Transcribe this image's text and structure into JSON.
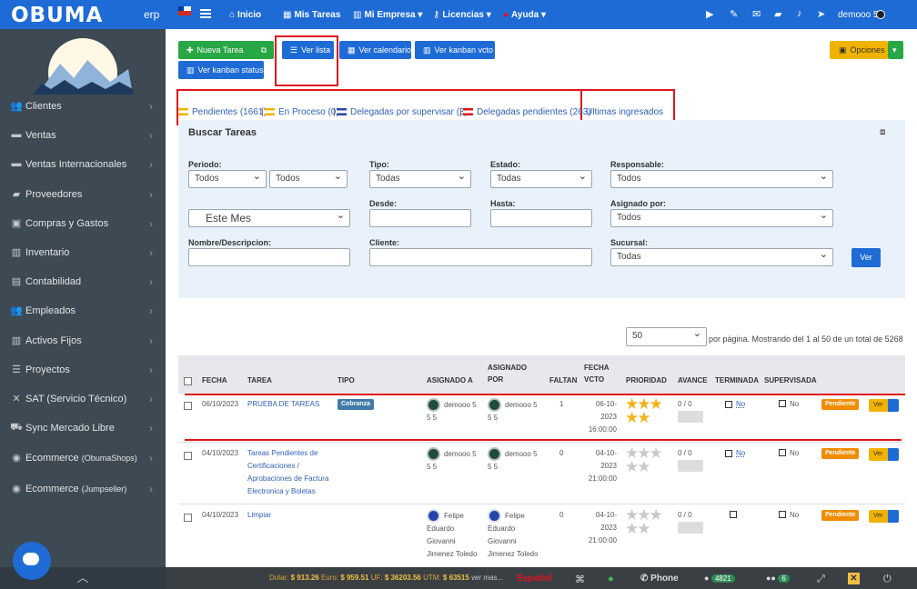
{
  "topbar": {
    "logo": "OBUMA",
    "logo_suffix": "erp",
    "nav": [
      "Inicio",
      "Mis Tareas",
      "Mi Empresa",
      "Licencias",
      "Ayuda"
    ],
    "user": "demooo 5"
  },
  "sidebar": {
    "items": [
      {
        "label": "Clientes",
        "icon": "users-icon"
      },
      {
        "label": "Ventas",
        "icon": "money-icon"
      },
      {
        "label": "Ventas Internacionales",
        "icon": "money-icon"
      },
      {
        "label": "Proveedores",
        "icon": "truck-icon"
      },
      {
        "label": "Compras y Gastos",
        "icon": "receipt-icon"
      },
      {
        "label": "Inventario",
        "icon": "barcode-icon"
      },
      {
        "label": "Contabilidad",
        "icon": "book-icon"
      },
      {
        "label": "Empleados",
        "icon": "users-icon"
      },
      {
        "label": "Activos Fijos",
        "icon": "barcode-icon"
      },
      {
        "label": "Proyectos",
        "icon": "list-icon"
      },
      {
        "label": "SAT (Servicio Técnico)",
        "icon": "tools-icon"
      },
      {
        "label": "Sync Mercado Libre",
        "icon": "cart-icon"
      },
      {
        "label": "Ecommerce",
        "sub": "(ObumaShops)",
        "icon": "globe-icon"
      },
      {
        "label": "Ecommerce",
        "sub": "(Jumpseller)",
        "icon": "globe-icon"
      }
    ]
  },
  "toolbar": {
    "nueva_tarea": "Nueva Tarea",
    "ver_lista": "Ver lista",
    "ver_calendario": "Ver calendario",
    "ver_kanban_vcto": "Ver kanban vcto",
    "ver_kanban_status": "Ver kanban status",
    "opciones": "Opciones"
  },
  "filters": {
    "pendientes": "Pendientes (1661)",
    "en_proceso": "En Proceso (0)",
    "delegadas_supervisar": "Delegadas por supervisar (3)",
    "delegadas_pendientes": "Delegadas pendientes (263)",
    "ultimas": "Ultimas ingresados"
  },
  "search": {
    "title": "Buscar Tareas",
    "periodo_label": "Periodo:",
    "periodo_1": "Todos",
    "periodo_2": "Todos",
    "periodo_3": "Este Mes",
    "tipo_label": "Tipo:",
    "tipo_value": "Todas",
    "estado_label": "Estado:",
    "estado_value": "Todas",
    "responsable_label": "Responsable:",
    "responsable_value": "Todos",
    "desde_label": "Desde:",
    "hasta_label": "Hasta:",
    "asignado_label": "Asignado por:",
    "asignado_value": "Todos",
    "nombre_label": "Nombre/Descripcion:",
    "cliente_label": "Cliente:",
    "sucursal_label": "Sucursal:",
    "sucursal_value": "Todas",
    "ver_button": "Ver"
  },
  "pagination": {
    "per_page": "50",
    "text": "por página. Mostrando del 1 al 50 de un total de 5268"
  },
  "table": {
    "headers": {
      "fecha": "FECHA",
      "tarea": "TAREA",
      "tipo": "TIPO",
      "asignado_a": "ASIGNADO A",
      "asignado_por_1": "ASIGNADO",
      "asignado_por_2": "POR",
      "faltan": "FALTAN",
      "fecha_vcto_1": "FECHA",
      "fecha_vcto_2": "VCTO",
      "prioridad": "PRIORIDAD",
      "avance": "AVANCE",
      "terminada": "TERMINADA",
      "supervisada": "SUPERVISADA"
    },
    "rows": [
      {
        "fecha": "06/10/2023",
        "tarea": [
          "PRUEBA DE TAREAS"
        ],
        "tipo": "Cobranza",
        "asig_a": [
          "demooo 5",
          "5 5"
        ],
        "asig_por": [
          "demooo 5",
          "5 5"
        ],
        "faltan": "1",
        "vcto": [
          "06-10-",
          "2023",
          "16:00:00"
        ],
        "stars": 5,
        "avance": "0 / 0",
        "terminada": "No",
        "supervisada": "No",
        "estado": "Pendiente",
        "ver": "Ver"
      },
      {
        "fecha": "04/10/2023",
        "tarea": [
          "Tareas Pendientes de",
          "Certificaciones /",
          "Aprobaciones de Factura",
          "Electronica y Boletas"
        ],
        "tipo": "",
        "asig_a": [
          "demooo 5",
          "5 5"
        ],
        "asig_por": [
          "demooo 5",
          "5 5"
        ],
        "faltan": "0",
        "vcto": [
          "04-10-",
          "2023",
          "21:00:00"
        ],
        "stars": 0,
        "avance": "0 / 0",
        "terminada": "No",
        "supervisada": "No",
        "estado": "Pendiente",
        "ver": "Ver"
      },
      {
        "fecha": "04/10/2023",
        "tarea": [
          "Limpiar"
        ],
        "tipo": "",
        "asig_a": [
          "Felipe",
          "Eduardo",
          "Giovanni",
          "Jimenez Toledo"
        ],
        "asig_por": [
          "Felipe",
          "Eduardo",
          "Giovanni",
          "Jimenez Toledo"
        ],
        "faltan": "0",
        "vcto": [
          "04-10-",
          "2023",
          "21:00:00"
        ],
        "stars": 0,
        "avance": "0 / 0",
        "terminada": "",
        "supervisada": "No",
        "estado": "Pendiente",
        "ver": "Ver"
      }
    ]
  },
  "statusbar": {
    "dolar_label": "Dolar:",
    "dolar": "$ 913.26",
    "euro_label": "Euro:",
    "euro": "$ 959.51",
    "uf_label": "UF:",
    "uf": "$ 36203.56",
    "utm_label": "UTM:",
    "utm": "$ 63515",
    "ver_mas": "ver mas...",
    "idioma": "Español",
    "phone": "Phone",
    "chat_count": "4821",
    "users_count": "6"
  },
  "colors": {
    "primary": "#1e6bd6",
    "sidebar": "#3d4a54",
    "accent_red": "#e0141e",
    "warning": "#f0b400"
  }
}
